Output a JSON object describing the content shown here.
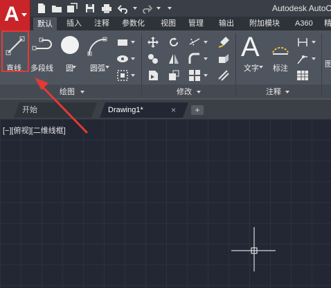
{
  "title_bar": {
    "title": "Autodesk AutoC"
  },
  "tabs": [
    {
      "label": "默认",
      "active": true
    },
    {
      "label": "插入"
    },
    {
      "label": "注释"
    },
    {
      "label": "参数化"
    },
    {
      "label": "视图"
    },
    {
      "label": "管理"
    },
    {
      "label": "输出"
    },
    {
      "label": "附加模块"
    },
    {
      "label": "A360"
    },
    {
      "label": "精"
    }
  ],
  "ribbon": {
    "draw_tools": {
      "line": "直线",
      "polyline": "多段线",
      "circle": "圆",
      "arc": "圆弧"
    },
    "annotation_tools": {
      "text": "文字",
      "dimension": "标注"
    },
    "panel_titles": {
      "draw": "绘图",
      "modify": "修改",
      "annotation": "注释"
    },
    "edge_label": "图"
  },
  "file_tabs": {
    "start": "开始",
    "drawing": "Drawing1*",
    "close_glyph": "×",
    "add_glyph": "+"
  },
  "viewport": {
    "label": "[−][俯视][二维线框]"
  },
  "colors": {
    "app_button": "#c8242a",
    "highlight": "#e53935",
    "canvas": "#222733",
    "ribbon": "#4f555e"
  }
}
